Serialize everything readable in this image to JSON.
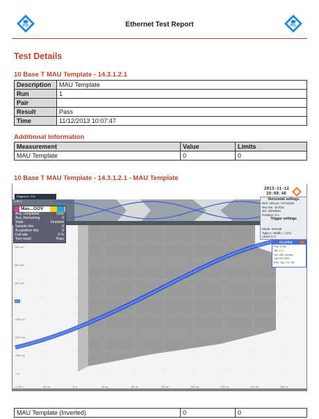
{
  "header": {
    "title": "Ethernet Test Report"
  },
  "section_title": "Test Details",
  "test": {
    "heading": "10 Base T MAU Template - 14.3.1.2.1",
    "rows": [
      {
        "key": "Description",
        "value": "MAU Template"
      },
      {
        "key": "Run",
        "value": "1"
      },
      {
        "key": "Pair",
        "value": ""
      },
      {
        "key": "Result",
        "value": "Pass"
      },
      {
        "key": "Time",
        "value": "11/12/2013 10:07:47"
      }
    ]
  },
  "additional": {
    "heading": "Additional Information",
    "columns": [
      "Measurement",
      "Value",
      "Limits"
    ],
    "rows": [
      [
        "MAU Template",
        "0",
        "0"
      ]
    ]
  },
  "screenshot": {
    "heading": "10 Base T MAU Template - 14.3.1.2.1 - MAU Template",
    "date": "2013-11-12",
    "time": "10:08:48",
    "diagram_label": "Diagram1: Ch1",
    "horizontal": {
      "title": "Horizontal settings",
      "lines": [
        "Res: 100 ps / 10 GSa/s",
        "Rec len: 10 kSa",
        "Scl: 20/100ns",
        "Position: 0 s"
      ]
    },
    "trigger": {
      "title": "Trigger settings",
      "lines": [
        "Mode: Normal",
        "Type A: Width ⊥ Ch1",
        "Level: 0 V"
      ]
    },
    "ch1": {
      "title": "C1 (Ch1)",
      "lines": [
        "Pos: 0 div",
        "Off: 0 V",
        "Scl: 250 mV/div",
        "Cpl: DC 50Ω",
        "Dec: Sa | Tk: Off"
      ]
    },
    "mask_test": {
      "title": "Mas...OOV",
      "rows": [
        [
          "Acq. completed",
          "1000"
        ],
        [
          "Acq. Remaining",
          "0"
        ],
        [
          "State",
          "Finished"
        ],
        [
          "Sample hits",
          "0"
        ],
        [
          "Acquisition hits",
          "0"
        ],
        [
          "Fail rate",
          "0 %"
        ],
        [
          "Test result",
          "Pass"
        ]
      ]
    },
    "top_y_labels": [
      "1.25 V",
      "750 mV",
      "500 mV"
    ],
    "main_y_labels": [
      "1.25 V",
      "750 mV",
      "500 mV",
      "250 mV",
      "0 V",
      "-250 mV",
      "-500 mV",
      "-750 mV",
      "-1 V",
      "-1.25 V"
    ],
    "x_labels": [
      "-40 ns",
      "0 s",
      "40 ns",
      "80 ns",
      "120 ns",
      "160 ns",
      "200 ns",
      "240 ns",
      "280 ns",
      "320 ns",
      "360 ns"
    ]
  },
  "inverted": {
    "rows": [
      [
        "MAU Template (Inverted)",
        "0",
        "0"
      ]
    ]
  },
  "colors": {
    "accent": "#b8412c",
    "waveform": "#1f4fd6",
    "mask": "#8a8a8a",
    "logo": "#1e88d8"
  }
}
